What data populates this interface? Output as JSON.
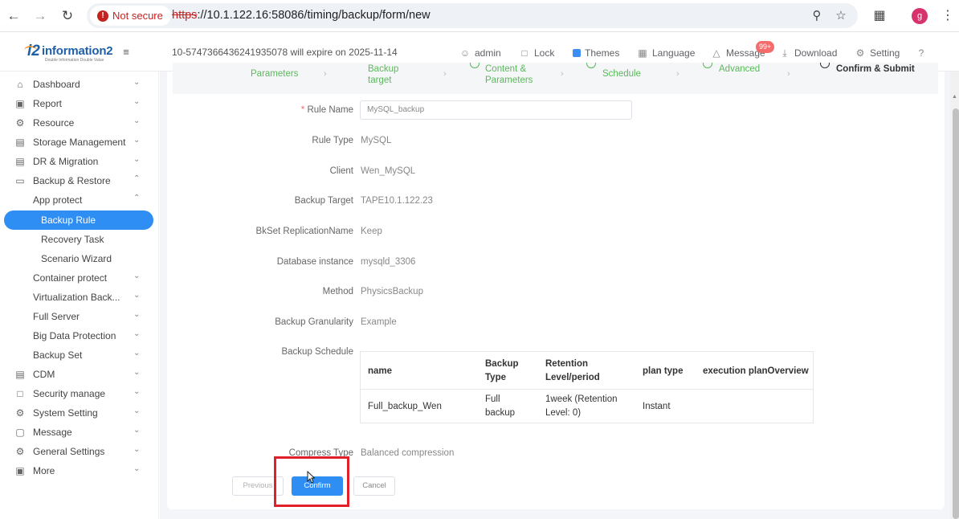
{
  "browser": {
    "security_label": "Not secure",
    "url_scheme": "https",
    "url_rest": "://10.1.122.16:58086/timing/backup/form/new",
    "profile_initial": "g"
  },
  "header": {
    "logo_text": "information2",
    "logo_prefix": "i2",
    "logo_tagline": "Double Information Double Value",
    "license_notice": "10-5747366436241935078 will expire on 2025-11-14",
    "user": "admin",
    "lock": "Lock",
    "themes": "Themes",
    "language": "Language",
    "message": "Message",
    "message_badge": "99+",
    "download": "Download",
    "setting": "Setting"
  },
  "sidebar": {
    "items": [
      {
        "label": "Dashboard",
        "icon": "home-icon"
      },
      {
        "label": "Report",
        "icon": "report-icon"
      },
      {
        "label": "Resource",
        "icon": "resource-icon"
      },
      {
        "label": "Storage Management",
        "icon": "storage-icon"
      },
      {
        "label": "DR & Migration",
        "icon": "dr-icon"
      },
      {
        "label": "Backup & Restore",
        "icon": "monitor-icon"
      },
      {
        "label": "App protect"
      },
      {
        "label": "Backup Rule"
      },
      {
        "label": "Recovery Task"
      },
      {
        "label": "Scenario Wizard"
      },
      {
        "label": "Container protect"
      },
      {
        "label": "Virtualization Back..."
      },
      {
        "label": "Full Server"
      },
      {
        "label": "Big Data Protection"
      },
      {
        "label": "Backup Set"
      },
      {
        "label": "CDM",
        "icon": "cdm-icon"
      },
      {
        "label": "Security manage",
        "icon": "lock-icon"
      },
      {
        "label": "System Setting",
        "icon": "gear-icon"
      },
      {
        "label": "Message",
        "icon": "message-icon"
      },
      {
        "label": "General Settings",
        "icon": "settings-icon"
      },
      {
        "label": "More",
        "icon": "more-icon"
      }
    ]
  },
  "steps": {
    "s1": "Parameters",
    "s2a": "Backup",
    "s2b": "target",
    "s3a": "Content &",
    "s3b": "Parameters",
    "s4": "Schedule",
    "s5": "Advanced",
    "s6": "Confirm & Submit"
  },
  "form": {
    "rule_name_label": "Rule Name",
    "rule_name_value": "MySQL_backup",
    "rule_type_label": "Rule Type",
    "rule_type_value": "MySQL",
    "client_label": "Client",
    "client_value": "Wen_MySQL",
    "backup_target_label": "Backup Target",
    "backup_target_value": "TAPE10.1.122.23",
    "bkset_label": "BkSet ReplicationName",
    "bkset_value": "Keep",
    "db_instance_label": "Database instance",
    "db_instance_value": "mysqld_3306",
    "method_label": "Method",
    "method_value": "PhysicsBackup",
    "granularity_label": "Backup Granularity",
    "granularity_value": "Example",
    "schedule_label": "Backup Schedule",
    "compress_label": "Compress Type",
    "compress_value": "Balanced compression"
  },
  "schedule_table": {
    "headers": {
      "name": "name",
      "backup_type_1": "Backup",
      "backup_type_2": "Type",
      "retention_1": "Retention",
      "retention_2": "Level/period",
      "plan_type": "plan type",
      "overview": "execution planOverview"
    },
    "row": {
      "name": "Full_backup_Wen",
      "type_1": "Full",
      "type_2": "backup",
      "retention_1": "1week  (Retention",
      "retention_2": "Level: 0)",
      "plan_type": "Instant",
      "overview": ""
    }
  },
  "buttons": {
    "previous": "Previous",
    "confirm": "Confirm",
    "cancel": "Cancel"
  },
  "colors": {
    "accent": "#2f8ef4",
    "highlight": "#e0202a",
    "step_done": "#5cb85c"
  }
}
